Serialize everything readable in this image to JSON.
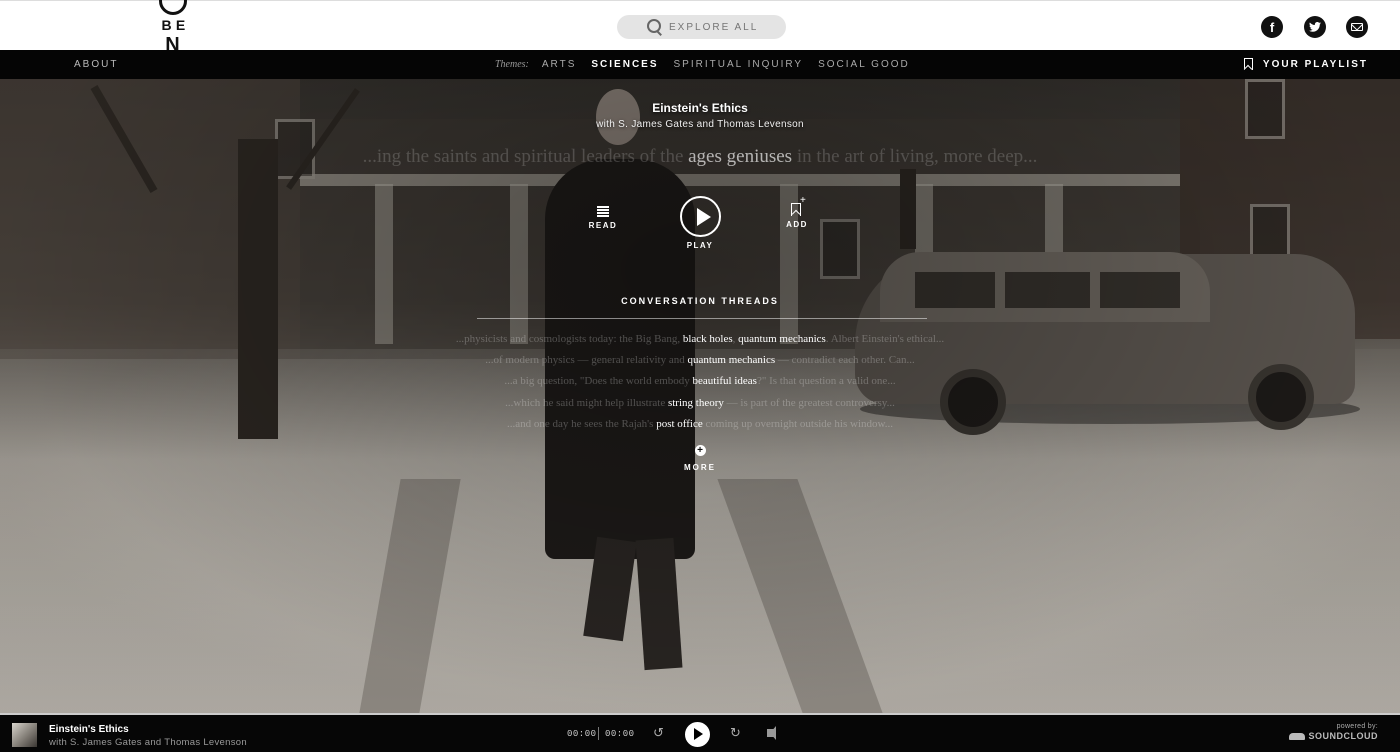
{
  "header": {
    "logo_letters": [
      "O",
      "B",
      "E",
      "N"
    ],
    "search_placeholder": "EXPLORE ALL",
    "social": {
      "facebook_glyph": "f",
      "twitter_glyph": "t"
    }
  },
  "nav": {
    "about": "ABOUT",
    "themes_label": "Themes:",
    "themes": [
      {
        "label": "ARTS",
        "active": false
      },
      {
        "label": "SCIENCES",
        "active": true
      },
      {
        "label": "SPIRITUAL INQUIRY",
        "active": false
      },
      {
        "label": "SOCIAL GOOD",
        "active": false
      }
    ],
    "playlist": "YOUR PLAYLIST"
  },
  "episode": {
    "title": "Einstein's Ethics",
    "guests": "with S. James Gates and Thomas Levenson",
    "quote_pre": "...ing the saints and spiritual leaders of the ",
    "quote_highlight": "ages geniuses",
    "quote_post": " in the art of living, more deep...",
    "actions": {
      "read": "READ",
      "play": "PLAY",
      "add": "ADD"
    },
    "threads_title": "CONVERSATION THREADS",
    "threads": [
      {
        "pre": "...physicists and cosmologists today: the Big Bang, ",
        "kw": "black holes",
        "mid": ", ",
        "kw2": "quantum mechanics",
        "post": ". Albert Einstein's ethical..."
      },
      {
        "pre": "...of modern physics — general relativity and ",
        "kw": "quantum mechanics",
        "mid": "",
        "kw2": "",
        "post": " — contradict each other. Can..."
      },
      {
        "pre": "...a big question, \"Does the world embody ",
        "kw": "beautiful ideas",
        "mid": "",
        "kw2": "",
        "post": "?\" Is that question a valid one..."
      },
      {
        "pre": "...which he said might help illustrate ",
        "kw": "string theory",
        "mid": "",
        "kw2": "",
        "post": " — is part of the greatest controversy..."
      },
      {
        "pre": "...and one day he sees the Rajah's ",
        "kw": "post office",
        "mid": "",
        "kw2": "",
        "post": " coming up overnight outside his window..."
      }
    ],
    "more": "MORE"
  },
  "player": {
    "title": "Einstein's Ethics",
    "subtitle": "with S. James Gates and Thomas Levenson",
    "current_time": "00:00",
    "duration": "00:00",
    "powered_by": "powered by:",
    "provider": "SOUNDCLOUD"
  },
  "colors": {
    "topbar_bg": "#ffffff",
    "navbar_bg": "#050505",
    "player_bg": "#060606",
    "text_primary": "#ffffff",
    "text_muted": "#aaaaaa"
  },
  "icons": {
    "search": "search-icon",
    "facebook": "facebook-icon",
    "twitter": "twitter-icon",
    "email": "email-icon",
    "bookmark": "bookmark-icon",
    "read": "lines-icon",
    "play": "play-icon",
    "add": "bookmark-add-icon",
    "more": "plus-circle-icon",
    "rewind": "rewind-icon",
    "forward": "forward-icon",
    "volume": "volume-icon",
    "cloud": "soundcloud-icon"
  }
}
